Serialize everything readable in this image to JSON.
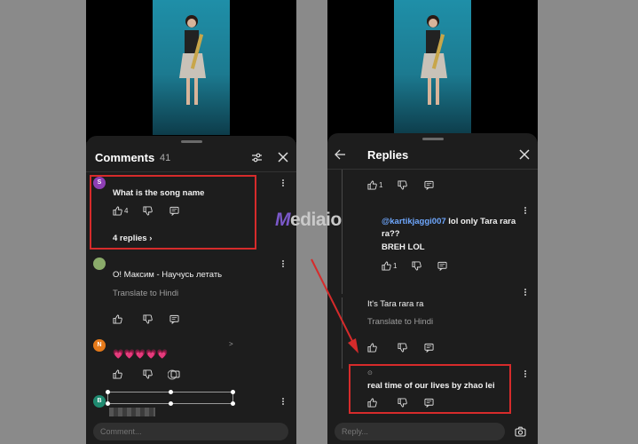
{
  "left_panel": {
    "title": "Comments",
    "count": "41",
    "comments": [
      {
        "avatar_letter": "S",
        "avatar_color": "#8e3fb5",
        "text": "What is the song name",
        "likes": "4",
        "replies_link": "4 replies"
      },
      {
        "avatar_letter": "",
        "avatar_color": "#8aab6a",
        "text": "О! Максим - Научусь летать",
        "translate": "Translate to Hindi"
      },
      {
        "avatar_letter": "N",
        "avatar_color": "#e57a1a",
        "text": "💗💗💗💗💗"
      },
      {
        "avatar_letter": "B",
        "avatar_color": "#1f8a70"
      }
    ],
    "input_placeholder": "Comment..."
  },
  "right_panel": {
    "title": "Replies",
    "replies": [
      {
        "likes": "1"
      },
      {
        "mention": "@kartikjaggi007",
        "text_after_mention": " lol only Tara rara",
        "text_line2": "ra??",
        "text_line3": "BREH LOL",
        "likes": "1"
      },
      {
        "text": "It's Tara rara ra",
        "translate": "Translate to Hindi"
      },
      {
        "text": "real time of our lives by zhao lei"
      }
    ],
    "input_placeholder": "Reply..."
  },
  "watermark": {
    "initial": "M",
    "rest": "ediaio"
  },
  "colors": {
    "annotation_red": "#d62b2b",
    "sheet_bg": "#1d1d1d",
    "mention_blue": "#6fa8ff"
  }
}
